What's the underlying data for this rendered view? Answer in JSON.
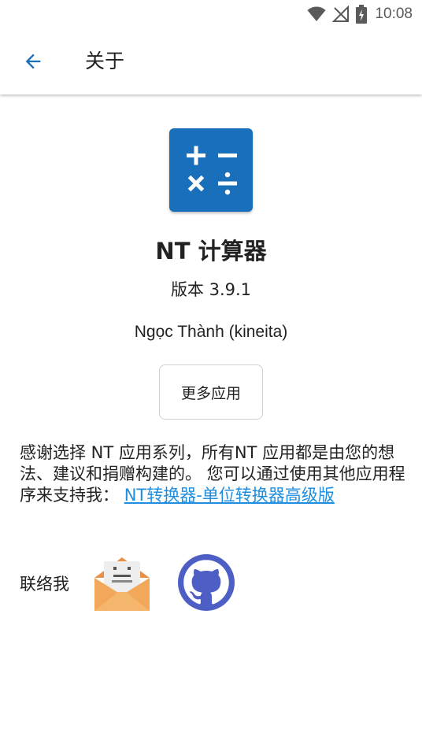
{
  "status_bar": {
    "time": "10:08",
    "icons": [
      "wifi-icon",
      "no-signal-icon",
      "battery-charging-icon"
    ]
  },
  "app_bar": {
    "back_icon": "arrow-left-icon",
    "title": "关于"
  },
  "about": {
    "app_name": "NT 计算器",
    "version": "版本 3.9.1",
    "author": "Ngọc Thành (kineita)",
    "more_apps_label": "更多应用",
    "thanks_text": "感谢选择 NT 应用系列，所有NT 应用都是由您的想法、建议和捐赠构建的。 您可以通过使用其他应用程序来支持我：",
    "thanks_link": "NT转换器-单位转换器高级版",
    "contact_label": "联络我",
    "contact_icons": [
      "email-icon",
      "github-icon"
    ]
  },
  "colors": {
    "accent": "#1a6fba",
    "link": "#1f8ee0",
    "email_envelope": "#f2a85a",
    "github": "#4d5fc4"
  }
}
